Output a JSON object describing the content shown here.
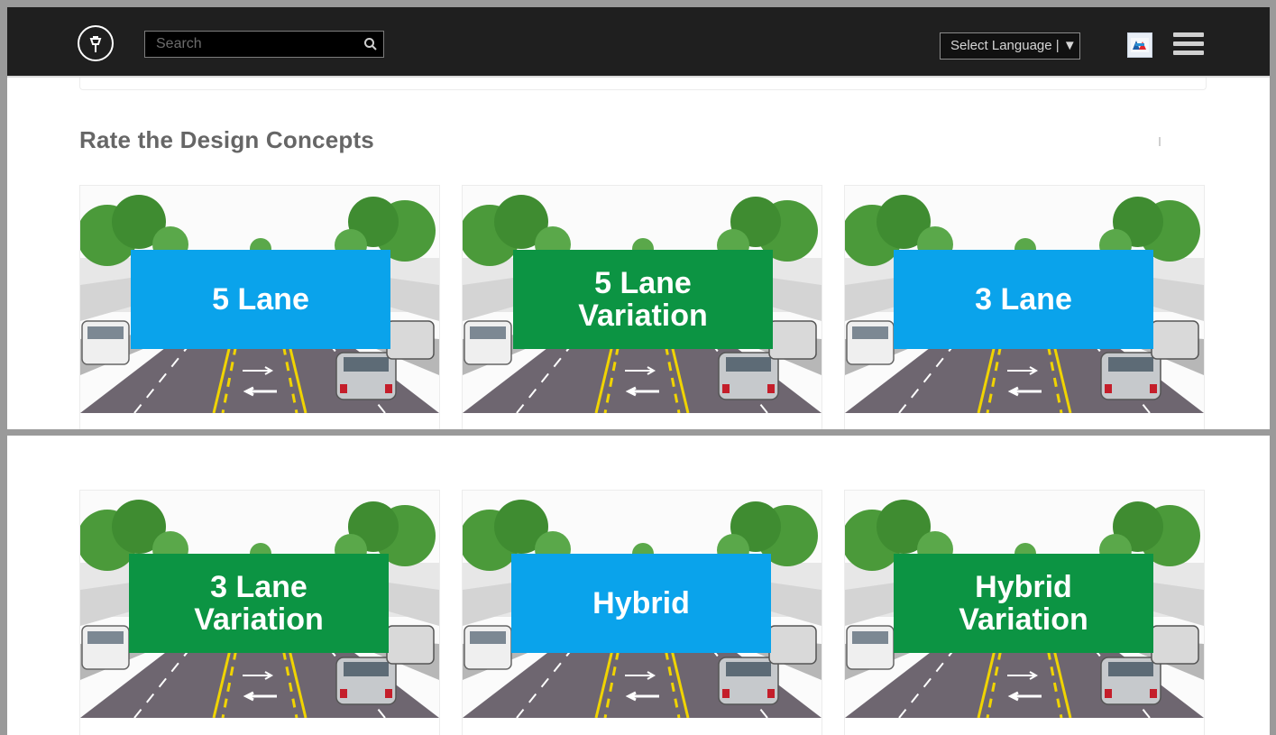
{
  "navbar": {
    "logo_icon": "streetlamp-logo-icon",
    "search_placeholder": "Search",
    "search_icon": "search-icon",
    "language_label": "Select Language | ▼",
    "flag_icon": "translate-flag-icon",
    "menu_icon": "hamburger-menu-icon"
  },
  "section": {
    "title": "Rate the Design Concepts"
  },
  "concepts": [
    {
      "label": "5 Lane",
      "color": "#0aa3eb"
    },
    {
      "label": "5 Lane\nVariation",
      "color": "#0c9443"
    },
    {
      "label": "3 Lane",
      "color": "#0aa3eb"
    },
    {
      "label": "3 Lane\nVariation",
      "color": "#0c9443"
    },
    {
      "label": "Hybrid",
      "color": "#0aa3eb"
    },
    {
      "label": "Hybrid\nVariation",
      "color": "#0c9443"
    }
  ],
  "colors": {
    "navbar": "#1f1f1f",
    "blue_label": "#0aa3eb",
    "green_label": "#0c9443",
    "heading": "#666666"
  }
}
